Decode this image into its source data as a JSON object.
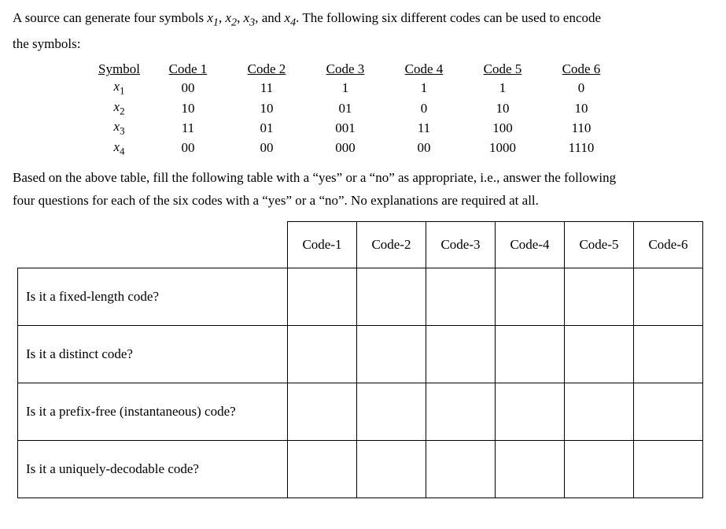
{
  "intro_line1": "A source can generate four symbols ",
  "intro_sym1_var": "x",
  "intro_sym1_sub": "1",
  "intro_sep": ", ",
  "intro_sym2_var": "x",
  "intro_sym2_sub": "2",
  "intro_sym3_var": "x",
  "intro_sym3_sub": "3",
  "intro_and": ", and ",
  "intro_sym4_var": "x",
  "intro_sym4_sub": "4",
  "intro_line1_tail": ". The following six different codes can be used to encode",
  "intro_line2": "the symbols:",
  "codes": {
    "headers": [
      "Symbol",
      "Code 1",
      "Code 2",
      "Code 3",
      "Code 4",
      "Code 5",
      "Code 6"
    ],
    "rows": [
      {
        "sym_var": "x",
        "sym_sub": "1",
        "c1": "00",
        "c2": "11",
        "c3": "1",
        "c4": "1",
        "c5": "1",
        "c6": "0"
      },
      {
        "sym_var": "x",
        "sym_sub": "2",
        "c1": "10",
        "c2": "10",
        "c3": "01",
        "c4": "0",
        "c5": "10",
        "c6": "10"
      },
      {
        "sym_var": "x",
        "sym_sub": "3",
        "c1": "11",
        "c2": "01",
        "c3": "001",
        "c4": "11",
        "c5": "100",
        "c6": "110"
      },
      {
        "sym_var": "x",
        "sym_sub": "4",
        "c1": "00",
        "c2": "00",
        "c3": "000",
        "c4": "00",
        "c5": "1000",
        "c6": "1110"
      }
    ]
  },
  "mid_line1": "Based on the above table, fill the following table with a “yes” or a “no” as appropriate, i.e., answer the following",
  "mid_line2": "four questions for each of the six codes with a “yes” or a “no”. No explanations are required at all.",
  "answer": {
    "col_headers": [
      "Code-1",
      "Code-2",
      "Code-3",
      "Code-4",
      "Code-5",
      "Code-6"
    ],
    "questions": [
      "Is it a fixed-length code?",
      "Is it a distinct code?",
      "Is it a prefix-free (instantaneous) code?",
      "Is it a uniquely-decodable code?"
    ]
  }
}
